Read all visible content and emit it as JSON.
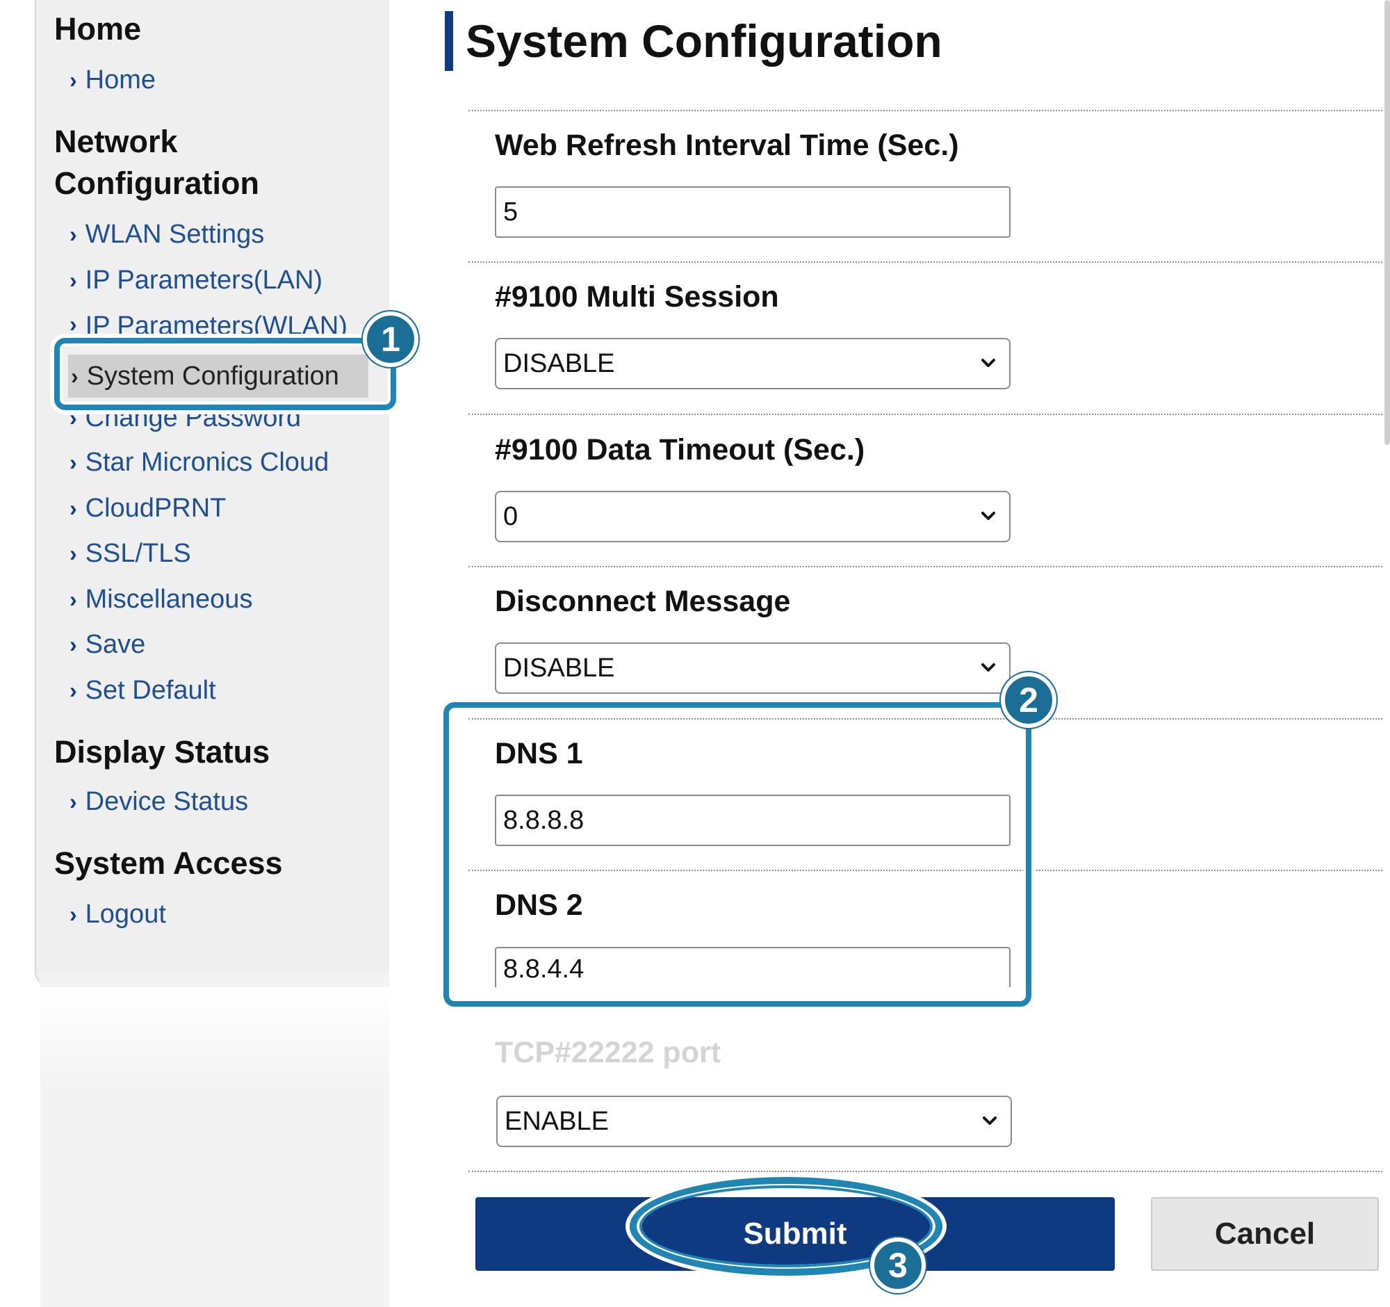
{
  "sidebar": {
    "sections": [
      {
        "heading": "Home",
        "items": [
          "Home"
        ]
      },
      {
        "heading_line1": "Network",
        "heading_line2": "Configuration",
        "items": [
          "WLAN Settings",
          "IP Parameters(LAN)",
          "IP Parameters(WLAN)",
          "System Configuration",
          "Change Password",
          "Star Micronics Cloud",
          "CloudPRNT",
          "SSL/TLS",
          "Miscellaneous",
          "Save",
          "Set Default"
        ]
      },
      {
        "heading": "Display Status",
        "items": [
          "Device Status"
        ]
      },
      {
        "heading": "System Access",
        "items": [
          "Logout"
        ]
      }
    ],
    "active_item": "System Configuration"
  },
  "main": {
    "title": "System Configuration",
    "fields": [
      {
        "label": "Web Refresh Interval Time (Sec.)",
        "type": "text",
        "value": "5"
      },
      {
        "label": "#9100 Multi Session",
        "type": "select",
        "value": "DISABLE"
      },
      {
        "label": "#9100 Data Timeout (Sec.)",
        "type": "select",
        "value": "0"
      },
      {
        "label": "Disconnect Message",
        "type": "select",
        "value": "DISABLE"
      },
      {
        "label": "DNS 1",
        "type": "text",
        "value": "8.8.8.8"
      },
      {
        "label": "DNS 2",
        "type": "text",
        "value": "8.8.4.4"
      },
      {
        "label": "TCP#22222 port",
        "type": "select",
        "value": "ENABLE"
      }
    ],
    "submit_label": "Submit",
    "cancel_label": "Cancel"
  },
  "callouts": {
    "step1": "1",
    "step2": "2",
    "step3": "3"
  },
  "icons": {
    "nav_item": "chevron-right-icon",
    "select": "chevron-down-icon"
  },
  "colors": {
    "accent": "#0d3a80",
    "link": "#1d4f91",
    "callout": "#1f85b3",
    "badge": "#1b6e96"
  }
}
